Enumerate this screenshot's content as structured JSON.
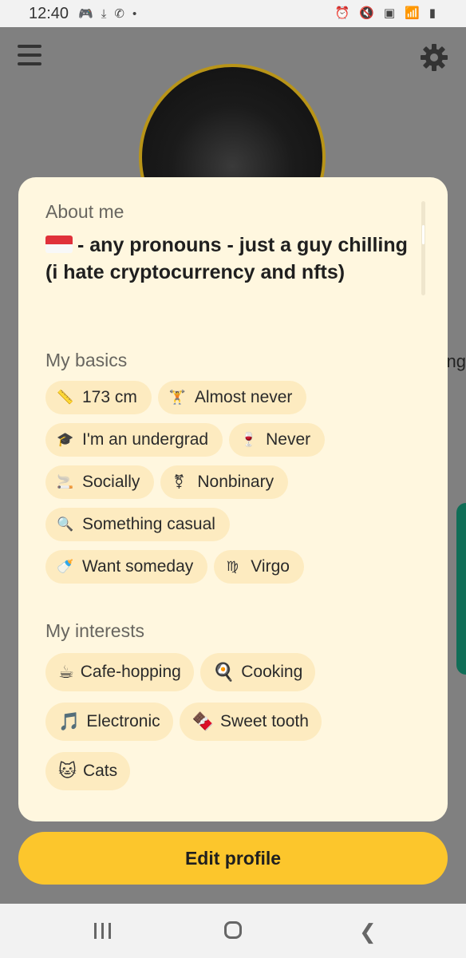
{
  "status_bar": {
    "time": "12:40"
  },
  "profile": {
    "side_text": "ng"
  },
  "card": {
    "about_title": "About me",
    "about_text": "- any pronouns - just a guy chilling (i hate cryptocurrency and nfts)",
    "basics_title": "My basics",
    "basics": [
      {
        "icon": "ruler-icon",
        "glyph": "📏",
        "label": "173 cm"
      },
      {
        "icon": "dumbbell-icon",
        "glyph": "🏋",
        "label": "Almost never"
      },
      {
        "icon": "graduation-cap-icon",
        "glyph": "🎓",
        "label": "I'm an undergrad"
      },
      {
        "icon": "wine-glass-icon",
        "glyph": "🍷",
        "label": "Never"
      },
      {
        "icon": "smoking-icon",
        "glyph": "🚬",
        "label": "Socially"
      },
      {
        "icon": "gender-icon",
        "glyph": "⚧",
        "label": "Nonbinary"
      },
      {
        "icon": "magnifier-icon",
        "glyph": "🔍",
        "label": "Something casual"
      },
      {
        "icon": "baby-bottle-icon",
        "glyph": "🍼",
        "label": "Want someday"
      },
      {
        "icon": "zodiac-icon",
        "glyph": "♍",
        "label": "Virgo"
      }
    ],
    "interests_title": "My interests",
    "interests": [
      {
        "icon": "coffee-icon",
        "glyph": "☕",
        "label": "Cafe-hopping"
      },
      {
        "icon": "frying-pan-icon",
        "glyph": "🍳",
        "label": "Cooking"
      },
      {
        "icon": "music-note-icon",
        "glyph": "🎵",
        "label": "Electronic"
      },
      {
        "icon": "chocolate-icon",
        "glyph": "🍫",
        "label": "Sweet tooth"
      },
      {
        "icon": "cat-icon",
        "glyph": "🐱",
        "label": "Cats"
      }
    ]
  },
  "edit_button": "Edit profile",
  "colors": {
    "accent": "#fcc62c",
    "card_bg": "#fff7df",
    "chip_bg": "#fdebc0"
  }
}
